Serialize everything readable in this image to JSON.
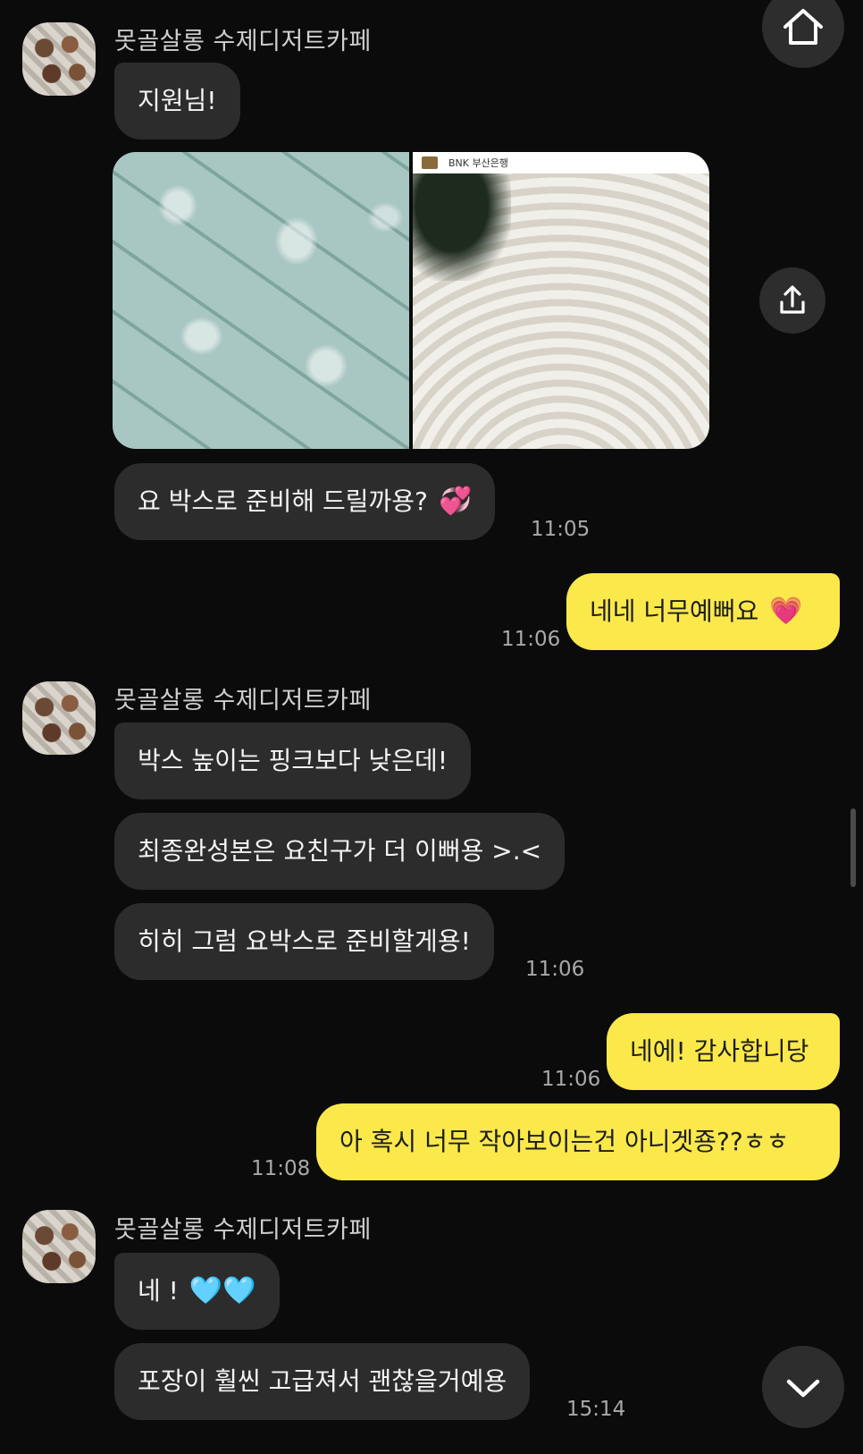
{
  "sender_name": "못골살롱 수제디저트카페",
  "buttons": {
    "home": "home-icon",
    "share": "share-icon",
    "scroll_down": "chevron-down-icon"
  },
  "image_post": {
    "caption": "BNK 부산은행"
  },
  "messages": [
    {
      "text": "지원님!"
    },
    {
      "text": "요 박스로 준비해 드릴까용?",
      "emoji": "💞",
      "time": "11:05"
    },
    {
      "text": "네네 너무예뻐요",
      "emoji": "💗",
      "time": "11:06"
    },
    {
      "text": "박스 높이는 핑크보다 낮은데!"
    },
    {
      "text": "최종완성본은 요친구가 더 이뻐용 >.<"
    },
    {
      "text": "히히 그럼 요박스로 준비할게용!",
      "time": "11:06"
    },
    {
      "text": "네에! 감사합니당",
      "time": "11:06"
    },
    {
      "text": "아 혹시 너무 작아보이는건 아니겟죵??ㅎㅎ",
      "time": "11:08"
    },
    {
      "text": "네 !",
      "emoji": "🩵🩵"
    },
    {
      "text": "포장이 훨씬 고급져서 괜찮을거예용",
      "time": "15:14"
    }
  ],
  "colors": {
    "background": "#0b0b0b",
    "incoming_bubble": "#2c2c2c",
    "outgoing_bubble": "#fbe84b"
  }
}
